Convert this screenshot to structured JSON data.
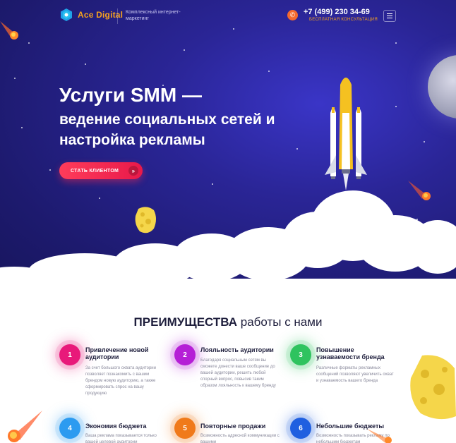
{
  "header": {
    "logo_text": "Ace Digital",
    "tagline": "Комплексный интернет-маркетинг",
    "phone": "+7 (499) 230 34-69",
    "consult": "БЕСПЛАТНАЯ КОНСУЛЬТАЦИЯ",
    "phone_icon": "phone-icon",
    "menu_icon": "hamburger-icon"
  },
  "hero": {
    "title": "Услуги SMM —",
    "subtitle": "ведение социальных сетей и настройка рекламы",
    "cta_label": "СТАТЬ КЛИЕНТОМ",
    "cta_arrow": "»"
  },
  "advantages": {
    "title_main": "ПРЕИМУЩЕСТВА",
    "title_rest": " работы с нами",
    "items": [
      {
        "num": "1",
        "title": "Привлечение новой аудитории",
        "text": "За счет большого охвата аудитории позволяет познакомить с вашим брендом новую аудиторию, а также сформировать спрос на вашу продукцию"
      },
      {
        "num": "2",
        "title": "Лояльность аудитории",
        "text": "Благодаря социальным сетям вы сможете донести ваше сообщение до вашей аудитории, решить любой спорный вопрос, повысив таким образом лояльность к вашему бренду"
      },
      {
        "num": "3",
        "title": "Повышение узнаваемости бренда",
        "text": "Различные форматы рекламных сообщений позволяют увеличить охват и узнаваемость вашего бренда"
      },
      {
        "num": "4",
        "title": "Экономия бюджета",
        "text": "Ваша реклама показывается только вашей целевой аудитории"
      },
      {
        "num": "5",
        "title": "Повторные продажи",
        "text": "Возможность адресной коммуникации с вашими"
      },
      {
        "num": "6",
        "title": "Небольшие бюджеты",
        "text": "Возможность показывать рекламу по небольшим бюджетам"
      }
    ]
  },
  "colors": {
    "hero_bg": "#2a2596",
    "accent_orange": "#f6a21e",
    "cta_red": "#ff3c5a",
    "heading": "#1e1e3c"
  }
}
